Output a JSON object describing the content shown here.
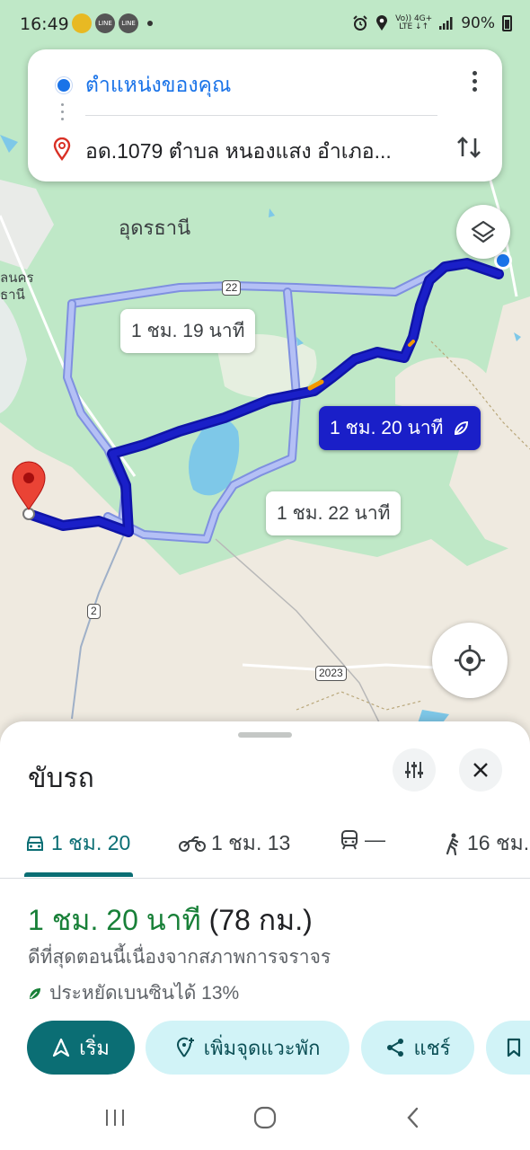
{
  "status_bar": {
    "time": "16:49",
    "network_top": "Vo)) 4G+",
    "network_bottom": "LTE ↓↑",
    "battery": "90%",
    "icons": [
      "alarm-icon",
      "location-icon",
      "signal-icon",
      "battery-icon"
    ]
  },
  "search": {
    "origin": "ตำแหน่งของคุณ",
    "destination": "อด.1079 ตำบล หนองแสง อำเภอ...",
    "icons": [
      "origin-dot-icon",
      "destination-pin-icon",
      "more-vert-icon",
      "swap-icon"
    ]
  },
  "map": {
    "city": "อุดรธานี",
    "town_partial_line1": "ลนคร",
    "town_partial_line2": "ธานี",
    "shields": {
      "r22": "22",
      "r2": "2",
      "r2023": "2023"
    },
    "routes": {
      "main_label": "1 ชม. 20 นาที",
      "alt1_label": "1 ชม. 19 นาที",
      "alt2_label": "1 ชม. 22 นาที"
    },
    "colors": {
      "primary_route": "#1a1fc8",
      "alt_route": "#a9b6f2",
      "water": "#7ec8e8",
      "green": "#bfe8c7",
      "land": "#efeae0"
    }
  },
  "sheet": {
    "title": "ขับรถ",
    "modes": [
      {
        "label": "1 ชม. 20",
        "icon": "car-icon",
        "active": true
      },
      {
        "label": "1 ชม. 13",
        "icon": "motorcycle-icon",
        "active": false
      },
      {
        "label": "—",
        "icon": "transit-icon",
        "active": false
      },
      {
        "label": "16 ชม.",
        "icon": "walk-icon",
        "active": false
      }
    ],
    "summary_time": "1 ชม. 20 นาที",
    "summary_distance": "(78 กม.)",
    "summary_note": "ดีที่สุดตอนนี้เนื่องจากสภาพการจราจร",
    "eco_note": "ประหยัดเบนซินได้ 13%",
    "actions": {
      "start": "เริ่ม",
      "add_stop": "เพิ่มจุดแวะพัก",
      "share": "แชร์"
    },
    "accent": "#0b6e74"
  },
  "nav_bar": [
    "recent-apps-icon",
    "home-icon",
    "back-icon"
  ]
}
